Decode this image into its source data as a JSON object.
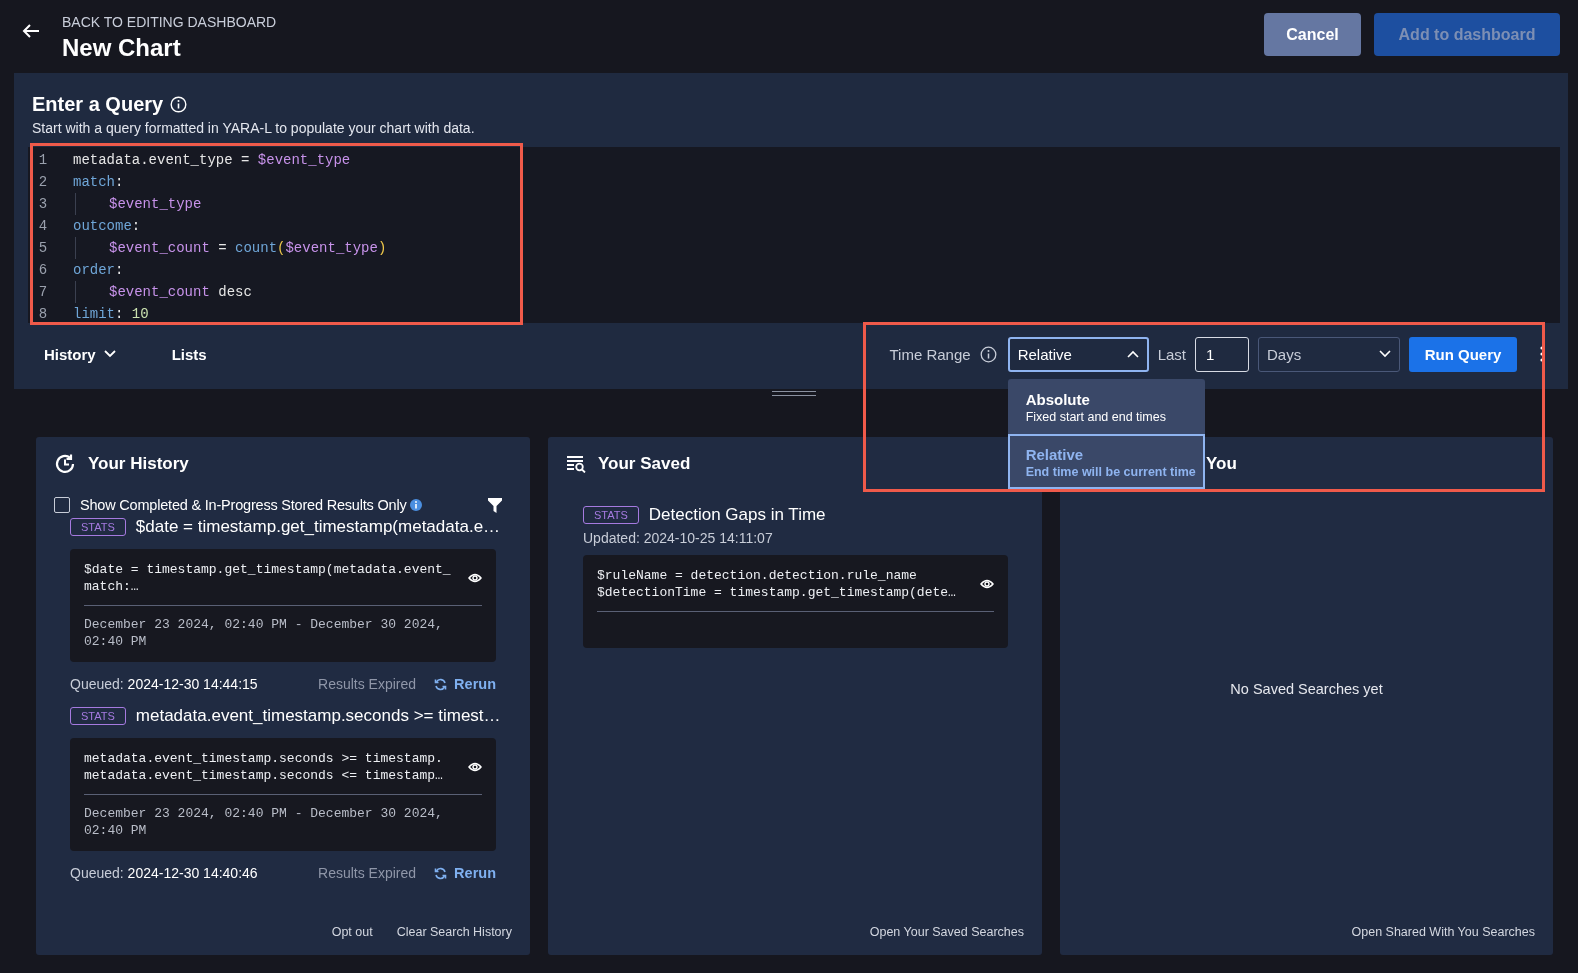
{
  "header": {
    "back_label": "BACK TO EDITING DASHBOARD",
    "title": "New Chart",
    "buttons": [
      {
        "label": "Cancel",
        "kind": "secondary",
        "disabled": false
      },
      {
        "label": "Add to dashboard",
        "kind": "primary",
        "disabled": true
      }
    ]
  },
  "query": {
    "title": "Enter a Query",
    "subtitle": "Start with a query formatted in YARA-L to populate your chart with data.",
    "lines": [
      {
        "number": "1",
        "tokens": [
          {
            "text": "metadata.event_type = ",
            "kind": "plain"
          },
          {
            "text": "$event_type",
            "kind": "variable"
          }
        ]
      },
      {
        "number": "2",
        "tokens": [
          {
            "text": "match",
            "kind": "keyword"
          },
          {
            "text": ":",
            "kind": "plain"
          }
        ]
      },
      {
        "number": "3",
        "tokens": [
          {
            "kind": "indent"
          },
          {
            "text": "$event_type",
            "kind": "variable"
          }
        ]
      },
      {
        "number": "4",
        "tokens": [
          {
            "text": "outcome",
            "kind": "keyword"
          },
          {
            "text": ":",
            "kind": "plain"
          }
        ]
      },
      {
        "number": "5",
        "tokens": [
          {
            "kind": "indent"
          },
          {
            "text": "$event_count",
            "kind": "variable"
          },
          {
            "text": " = ",
            "kind": "plain"
          },
          {
            "text": "count",
            "kind": "keyword"
          },
          {
            "text": "(",
            "kind": "paren"
          },
          {
            "text": "$event_type",
            "kind": "variable"
          },
          {
            "text": ")",
            "kind": "paren"
          }
        ]
      },
      {
        "number": "6",
        "tokens": [
          {
            "text": "order",
            "kind": "keyword"
          },
          {
            "text": ":",
            "kind": "plain"
          }
        ]
      },
      {
        "number": "7",
        "tokens": [
          {
            "kind": "indent"
          },
          {
            "text": "$event_count",
            "kind": "variable"
          },
          {
            "text": " desc",
            "kind": "plain"
          }
        ]
      },
      {
        "number": "8",
        "tokens": [
          {
            "text": "limit",
            "kind": "keyword"
          },
          {
            "text": ": ",
            "kind": "plain"
          },
          {
            "text": "10",
            "kind": "number"
          }
        ]
      }
    ]
  },
  "toolbar": {
    "tabs": [
      {
        "label": "History",
        "dropdown": true
      },
      {
        "label": "Lists",
        "dropdown": false
      }
    ],
    "time_range": {
      "label": "Time Range",
      "mode": "Relative",
      "expanded": true,
      "options": [
        {
          "title": "Absolute",
          "description": "Fixed start and end times",
          "selected": false
        },
        {
          "title": "Relative",
          "description": "End time will be current time",
          "selected": true
        }
      ],
      "last_label": "Last",
      "amount": "1",
      "unit": "Days"
    },
    "run_button": "Run Query"
  },
  "history": {
    "title": "Your History",
    "filter": {
      "label": "Show Completed & In-Progress Stored Results Only",
      "checked": false
    },
    "items": [
      {
        "tag": "STATS",
        "title": "$date = timestamp.get_timestamp(metadata.e…",
        "code": [
          "$date = timestamp.get_timestamp(metadata.event_",
          "match:…"
        ],
        "range": [
          "December 23 2024, 02:40 PM - December 30 2024,",
          "02:40 PM"
        ],
        "queued_label": "Queued:",
        "queued": "2024-12-30 14:44:15",
        "status": "Results Expired",
        "action": "Rerun"
      },
      {
        "tag": "STATS",
        "title": "metadata.event_timestamp.seconds >= timest…",
        "code": [
          "metadata.event_timestamp.seconds >= timestamp.",
          "metadata.event_timestamp.seconds <= timestamp…"
        ],
        "range": [
          "December 23 2024, 02:40 PM - December 30 2024,",
          "02:40 PM"
        ],
        "queued_label": "Queued:",
        "queued": "2024-12-30 14:40:46",
        "status": "Results Expired",
        "action": "Rerun"
      }
    ],
    "links": [
      "Opt out",
      "Clear Search History"
    ]
  },
  "saved": {
    "title": "Your Saved",
    "items": [
      {
        "tag": "STATS",
        "title": "Detection Gaps in Time",
        "updated": "Updated: 2024-10-25 14:11:07",
        "code": [
          "$ruleName = detection.detection.rule_name",
          "$detectionTime = timestamp.get_timestamp(dete…"
        ]
      }
    ],
    "link": "Open Your Saved Searches"
  },
  "shared": {
    "title": "You",
    "empty": "No Saved Searches yet",
    "link": "Open Shared With You Searches"
  }
}
